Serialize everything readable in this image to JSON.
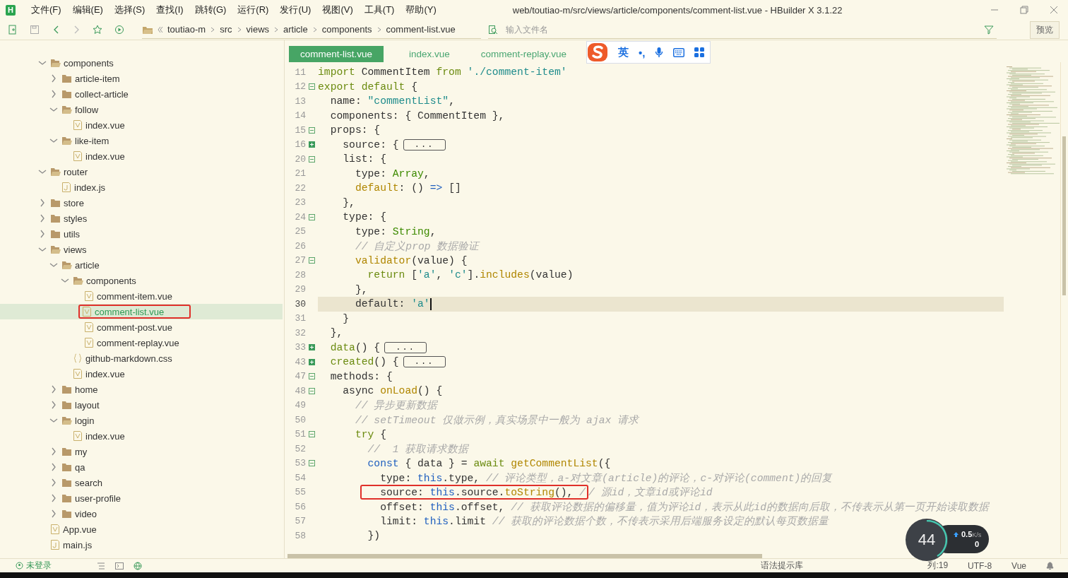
{
  "app": {
    "logo": "H",
    "title": "web/toutiao-m/src/views/article/components/comment-list.vue - HBuilder X 3.1.22"
  },
  "menu": [
    "文件(F)",
    "编辑(E)",
    "选择(S)",
    "查找(I)",
    "跳转(G)",
    "运行(R)",
    "发行(U)",
    "视图(V)",
    "工具(T)",
    "帮助(Y)"
  ],
  "breadcrumb": [
    "toutiao-m",
    "src",
    "views",
    "article",
    "components",
    "comment-list.vue"
  ],
  "file_search": {
    "placeholder": "输入文件名"
  },
  "preview_button": "预览",
  "tree": {
    "items": [
      {
        "name": "components",
        "kind": "folder",
        "expanded": true,
        "selected": false,
        "marked": false,
        "children": [
          {
            "name": "article-item",
            "kind": "folder",
            "expanded": false,
            "selected": false,
            "marked": false
          },
          {
            "name": "collect-article",
            "kind": "folder",
            "expanded": false,
            "selected": false,
            "marked": false
          },
          {
            "name": "follow",
            "kind": "folder",
            "expanded": true,
            "selected": false,
            "marked": false,
            "children": [
              {
                "name": "index.vue",
                "kind": "vue_file",
                "selected": false,
                "marked": false
              }
            ]
          },
          {
            "name": "like-item",
            "kind": "folder",
            "expanded": true,
            "selected": false,
            "marked": false,
            "children": [
              {
                "name": "index.vue",
                "kind": "vue_file",
                "selected": false,
                "marked": false
              }
            ]
          }
        ]
      },
      {
        "name": "router",
        "kind": "folder",
        "expanded": true,
        "selected": false,
        "marked": false,
        "children": [
          {
            "name": "index.js",
            "kind": "js_file",
            "selected": false,
            "marked": false
          }
        ]
      },
      {
        "name": "store",
        "kind": "folder",
        "expanded": false,
        "selected": false,
        "marked": false
      },
      {
        "name": "styles",
        "kind": "folder",
        "expanded": false,
        "selected": false,
        "marked": false
      },
      {
        "name": "utils",
        "kind": "folder",
        "expanded": false,
        "selected": false,
        "marked": false
      },
      {
        "name": "views",
        "kind": "folder",
        "expanded": true,
        "selected": false,
        "marked": false,
        "children": [
          {
            "name": "article",
            "kind": "folder",
            "expanded": true,
            "selected": false,
            "marked": false,
            "children": [
              {
                "name": "components",
                "kind": "folder",
                "expanded": true,
                "selected": false,
                "marked": false,
                "children": [
                  {
                    "name": "comment-item.vue",
                    "kind": "vue_file",
                    "selected": false,
                    "marked": false
                  },
                  {
                    "name": "comment-list.vue",
                    "kind": "vue_file",
                    "selected": true,
                    "marked": true
                  },
                  {
                    "name": "comment-post.vue",
                    "kind": "vue_file",
                    "selected": false,
                    "marked": false
                  },
                  {
                    "name": "comment-replay.vue",
                    "kind": "vue_file",
                    "selected": false,
                    "marked": false
                  }
                ]
              },
              {
                "name": "github-markdown.css",
                "kind": "css_file",
                "selected": false,
                "marked": false
              },
              {
                "name": "index.vue",
                "kind": "vue_file",
                "selected": false,
                "marked": false
              }
            ]
          },
          {
            "name": "home",
            "kind": "folder",
            "expanded": false,
            "selected": false,
            "marked": false
          },
          {
            "name": "layout",
            "kind": "folder",
            "expanded": false,
            "selected": false,
            "marked": false
          },
          {
            "name": "login",
            "kind": "folder",
            "expanded": true,
            "selected": false,
            "marked": false,
            "children": [
              {
                "name": "index.vue",
                "kind": "vue_file",
                "selected": false,
                "marked": false
              }
            ]
          },
          {
            "name": "my",
            "kind": "folder",
            "expanded": false,
            "selected": false,
            "marked": false
          },
          {
            "name": "qa",
            "kind": "folder",
            "expanded": false,
            "selected": false,
            "marked": false
          },
          {
            "name": "search",
            "kind": "folder",
            "expanded": false,
            "selected": false,
            "marked": false
          },
          {
            "name": "user-profile",
            "kind": "folder",
            "expanded": false,
            "selected": false,
            "marked": false
          },
          {
            "name": "video",
            "kind": "folder",
            "expanded": false,
            "selected": false,
            "marked": false
          }
        ]
      },
      {
        "name": "App.vue",
        "kind": "vue_file",
        "selected": false,
        "marked": false
      },
      {
        "name": "main.js",
        "kind": "js_file",
        "selected": false,
        "marked": false
      }
    ]
  },
  "tabs": [
    {
      "label": "comment-list.vue",
      "selected": true
    },
    {
      "label": "index.vue",
      "selected": false
    },
    {
      "label": "comment-replay.vue",
      "selected": false
    }
  ],
  "ime_bar": {
    "mode": "英",
    "punctuation": "•,"
  },
  "code": {
    "lines": [
      {
        "number": "11",
        "kind": "plain",
        "current": false,
        "tokens": [
          {
            "kind": "keyword",
            "text": "import"
          },
          {
            "kind": "plain",
            "text": " CommentItem "
          },
          {
            "kind": "keyword",
            "text": "from"
          },
          {
            "kind": "string",
            "text": " './comment-item'"
          }
        ]
      },
      {
        "number": "12",
        "kind": "foldable",
        "current": false,
        "tokens": [
          {
            "kind": "keyword",
            "text": "export default"
          },
          {
            "kind": "plain",
            "text": " {"
          }
        ]
      },
      {
        "number": "13",
        "kind": "plain",
        "current": false,
        "tokens": [
          {
            "kind": "plain",
            "text": "  name: "
          },
          {
            "kind": "string",
            "text": "\"commentList\""
          },
          {
            "kind": "plain",
            "text": ","
          }
        ]
      },
      {
        "number": "14",
        "kind": "plain",
        "current": false,
        "tokens": [
          {
            "kind": "plain",
            "text": "  components: { CommentItem },"
          }
        ]
      },
      {
        "number": "15",
        "kind": "foldable",
        "current": false,
        "tokens": [
          {
            "kind": "plain",
            "text": "  props: {"
          }
        ]
      },
      {
        "number": "16",
        "kind": "folded",
        "current": false,
        "tokens": [
          {
            "kind": "plain",
            "text": "    source: {"
          },
          {
            "kind": "folded",
            "text": "..."
          }
        ]
      },
      {
        "number": "20",
        "kind": "foldable",
        "current": false,
        "tokens": [
          {
            "kind": "plain",
            "text": "    list: {"
          }
        ]
      },
      {
        "number": "21",
        "kind": "plain",
        "current": false,
        "tokens": [
          {
            "kind": "plain",
            "text": "      type: "
          },
          {
            "kind": "type",
            "text": "Array"
          },
          {
            "kind": "plain",
            "text": ","
          }
        ]
      },
      {
        "number": "22",
        "kind": "plain",
        "current": false,
        "tokens": [
          {
            "kind": "function",
            "text": "      default"
          },
          {
            "kind": "plain",
            "text": ": () "
          },
          {
            "kind": "this",
            "text": "=>"
          },
          {
            "kind": "plain",
            "text": " []"
          }
        ]
      },
      {
        "number": "23",
        "kind": "plain",
        "current": false,
        "tokens": [
          {
            "kind": "plain",
            "text": "    },"
          }
        ]
      },
      {
        "number": "24",
        "kind": "foldable",
        "current": false,
        "tokens": [
          {
            "kind": "plain",
            "text": "    type: {"
          }
        ]
      },
      {
        "number": "25",
        "kind": "plain",
        "current": false,
        "tokens": [
          {
            "kind": "plain",
            "text": "      type: "
          },
          {
            "kind": "type",
            "text": "String"
          },
          {
            "kind": "plain",
            "text": ","
          }
        ]
      },
      {
        "number": "26",
        "kind": "plain",
        "current": false,
        "tokens": [
          {
            "kind": "comment",
            "text": "      // 自定义prop 数据验证"
          }
        ]
      },
      {
        "number": "27",
        "kind": "foldable",
        "current": false,
        "tokens": [
          {
            "kind": "function",
            "text": "      validator"
          },
          {
            "kind": "plain",
            "text": "(value) {"
          }
        ]
      },
      {
        "number": "28",
        "kind": "plain",
        "current": false,
        "tokens": [
          {
            "kind": "keyword",
            "text": "        return"
          },
          {
            "kind": "plain",
            "text": " ["
          },
          {
            "kind": "string",
            "text": "'a'"
          },
          {
            "kind": "plain",
            "text": ", "
          },
          {
            "kind": "string",
            "text": "'c'"
          },
          {
            "kind": "plain",
            "text": "]."
          },
          {
            "kind": "function",
            "text": "includes"
          },
          {
            "kind": "plain",
            "text": "(value)"
          }
        ]
      },
      {
        "number": "29",
        "kind": "plain",
        "current": false,
        "tokens": [
          {
            "kind": "plain",
            "text": "      },"
          }
        ]
      },
      {
        "number": "30",
        "kind": "plain",
        "current": true,
        "tokens": [
          {
            "kind": "plain",
            "text": "      default: "
          },
          {
            "kind": "string",
            "text": "'a'"
          }
        ]
      },
      {
        "number": "31",
        "kind": "plain",
        "current": false,
        "tokens": [
          {
            "kind": "plain",
            "text": "    }"
          }
        ]
      },
      {
        "number": "32",
        "kind": "plain",
        "current": false,
        "tokens": [
          {
            "kind": "plain",
            "text": "  },"
          }
        ]
      },
      {
        "number": "33",
        "kind": "folded",
        "current": false,
        "tokens": [
          {
            "kind": "keyword",
            "text": "  data"
          },
          {
            "kind": "plain",
            "text": "() {"
          },
          {
            "kind": "folded",
            "text": "..."
          }
        ]
      },
      {
        "number": "43",
        "kind": "folded",
        "current": false,
        "tokens": [
          {
            "kind": "keyword",
            "text": "  created"
          },
          {
            "kind": "plain",
            "text": "() {"
          },
          {
            "kind": "folded",
            "text": "..."
          }
        ]
      },
      {
        "number": "47",
        "kind": "foldable",
        "current": false,
        "tokens": [
          {
            "kind": "plain",
            "text": "  methods: {"
          }
        ]
      },
      {
        "number": "48",
        "kind": "foldable",
        "current": false,
        "tokens": [
          {
            "kind": "plain",
            "text": "    async "
          },
          {
            "kind": "function",
            "text": "onLoad"
          },
          {
            "kind": "plain",
            "text": "() {"
          }
        ]
      },
      {
        "number": "49",
        "kind": "plain",
        "current": false,
        "tokens": [
          {
            "kind": "comment",
            "text": "      // 异步更新数据"
          }
        ]
      },
      {
        "number": "50",
        "kind": "plain",
        "current": false,
        "tokens": [
          {
            "kind": "comment",
            "text": "      // setTimeout 仅做示例，真实场景中一般为 ajax 请求"
          }
        ]
      },
      {
        "number": "51",
        "kind": "foldable",
        "current": false,
        "tokens": [
          {
            "kind": "keyword",
            "text": "      try"
          },
          {
            "kind": "plain",
            "text": " {"
          }
        ]
      },
      {
        "number": "52",
        "kind": "plain",
        "current": false,
        "tokens": [
          {
            "kind": "comment",
            "text": "        //  1 获取请求数据"
          }
        ]
      },
      {
        "number": "53",
        "kind": "foldable",
        "current": false,
        "tokens": [
          {
            "kind": "this",
            "text": "        const"
          },
          {
            "kind": "plain",
            "text": " { data } = "
          },
          {
            "kind": "keyword",
            "text": "await "
          },
          {
            "kind": "function",
            "text": "getCommentList"
          },
          {
            "kind": "plain",
            "text": "({"
          }
        ]
      },
      {
        "number": "54",
        "kind": "plain",
        "current": false,
        "tokens": [
          {
            "kind": "plain",
            "text": "          type: "
          },
          {
            "kind": "this",
            "text": "this"
          },
          {
            "kind": "plain",
            "text": ".type, "
          },
          {
            "kind": "comment",
            "text": "// 评论类型，a-对文章(article)的评论，c-对评论(comment)的回复"
          }
        ]
      },
      {
        "number": "55",
        "kind": "plain",
        "current": false,
        "tokens": [
          {
            "kind": "plain",
            "text": "          source: ",
            "boxed": true
          },
          {
            "kind": "this",
            "text": "this",
            "boxed": true
          },
          {
            "kind": "plain",
            "text": ".source.",
            "boxed": true
          },
          {
            "kind": "function",
            "text": "toString",
            "boxed": true
          },
          {
            "kind": "plain",
            "text": "(), ",
            "boxed": true
          },
          {
            "kind": "comment",
            "text": "/",
            "boxed": true
          },
          {
            "kind": "comment",
            "text": "/ 源id，文章id或评论id",
            "boxed": false
          }
        ]
      },
      {
        "number": "56",
        "kind": "plain",
        "current": false,
        "tokens": [
          {
            "kind": "plain",
            "text": "          offset: "
          },
          {
            "kind": "this",
            "text": "this"
          },
          {
            "kind": "plain",
            "text": ".offset, "
          },
          {
            "kind": "comment",
            "text": "// 获取评论数据的偏移量，值为评论id，表示从此id的数据向后取，不传表示从第一页开始读取数据"
          }
        ]
      },
      {
        "number": "57",
        "kind": "plain",
        "current": false,
        "tokens": [
          {
            "kind": "plain",
            "text": "          limit: "
          },
          {
            "kind": "this",
            "text": "this"
          },
          {
            "kind": "plain",
            "text": ".limit "
          },
          {
            "kind": "comment",
            "text": "// 获取的评论数据个数，不传表示采用后端服务设定的默认每页数据量"
          }
        ]
      },
      {
        "number": "58",
        "kind": "plain",
        "current": false,
        "tokens": [
          {
            "kind": "plain",
            "text": "        })"
          }
        ]
      }
    ]
  },
  "speed_widget": {
    "percent": "44",
    "upload": "0.5",
    "unit": "K/s",
    "download": "0"
  },
  "status_bar": {
    "login": "未登录",
    "hint_library": "语法提示库",
    "column": "列:19",
    "encoding": "UTF-8",
    "language": "Vue"
  }
}
